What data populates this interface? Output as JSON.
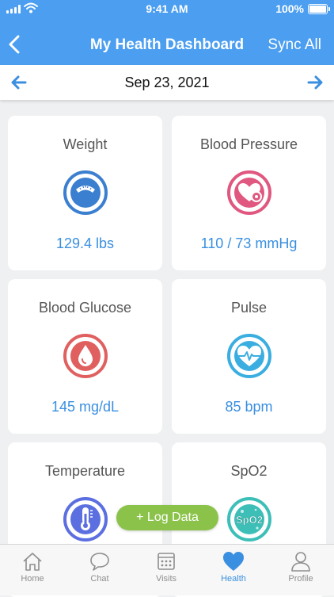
{
  "status_bar": {
    "time": "9:41 AM",
    "battery": "100%"
  },
  "nav": {
    "title": "My Health Dashboard",
    "action": "Sync All"
  },
  "date_bar": {
    "date": "Sep 23, 2021"
  },
  "cards": [
    {
      "label": "Weight",
      "value": "129.4 lbs",
      "icon": "scale-icon",
      "color": "#3b7fd0"
    },
    {
      "label": "Blood Pressure",
      "value": "110 / 73 mmHg",
      "icon": "heart-gauge-icon",
      "color": "#e0577f"
    },
    {
      "label": "Blood Glucose",
      "value": "145 mg/dL",
      "icon": "blood-drop-icon",
      "color": "#e06060"
    },
    {
      "label": "Pulse",
      "value": "85 bpm",
      "icon": "heartbeat-icon",
      "color": "#3aaee0"
    },
    {
      "label": "Temperature",
      "value": "",
      "icon": "thermometer-icon",
      "color": "#5b6fe0"
    },
    {
      "label": "SpO2",
      "value": "",
      "icon": "spo2-icon",
      "color": "#3dbfb8",
      "icon_text": "SpO2"
    }
  ],
  "log_button": {
    "label": "+ Log Data",
    "color": "#8bc34a"
  },
  "tabs": [
    {
      "label": "Home",
      "icon": "home-icon"
    },
    {
      "label": "Chat",
      "icon": "chat-icon"
    },
    {
      "label": "Visits",
      "icon": "calendar-icon"
    },
    {
      "label": "Health",
      "icon": "heart-icon",
      "active": true
    },
    {
      "label": "Profile",
      "icon": "profile-icon"
    }
  ],
  "colors": {
    "header": "#4b9ef0",
    "accent": "#3a8fe0",
    "log_button": "#8bc34a"
  }
}
